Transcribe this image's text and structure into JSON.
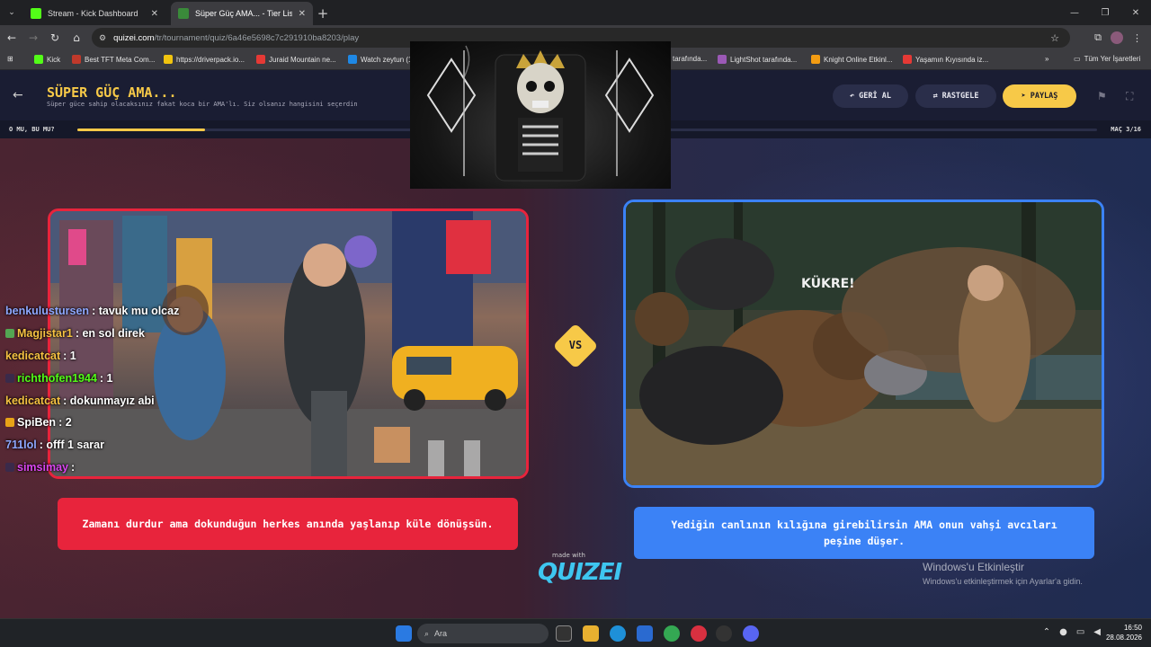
{
  "browser": {
    "tabs": [
      {
        "title": "Stream - Kick Dashboard",
        "favicon_color": "#53fc18"
      },
      {
        "title": "Süper Güç AMA... - Tier List, Kö",
        "favicon_color": "#3a8a3a"
      }
    ],
    "url_host": "quizei.com",
    "url_path": "/tr/tournament/quiz/6a46e5698c7c291910ba8203/play",
    "bookmarks": [
      {
        "label": "Kick",
        "color": "#53fc18"
      },
      {
        "label": "Best TFT Meta Com...",
        "color": "#c0392b"
      },
      {
        "label": "https://driverpack.io...",
        "color": "#f1c40f"
      },
      {
        "label": "Juraid Mountain ne...",
        "color": "#e53935"
      },
      {
        "label": "Watch zeytun (1",
        "color": "#1e88e5"
      },
      {
        "label": "tarafında...",
        "color": "#888888"
      },
      {
        "label": "LightShot tarafında...",
        "color": "#9b59b6"
      },
      {
        "label": "Knight Online Etkinl...",
        "color": "#f39c12"
      },
      {
        "label": "Yaşamın Kıyısında iz...",
        "color": "#e53935"
      }
    ],
    "all_bookmarks_label": "Tüm Yer İşaretleri"
  },
  "quiz": {
    "title": "SÜPER GÜÇ AMA...",
    "subtitle": "Süper güce sahip olacaksınız fakat koca bir AMA'lı. Siz olsanız hangisini seçerdin",
    "buttons": {
      "undo": "GERİ AL",
      "random": "RASTGELE",
      "share": "PAYLAŞ"
    },
    "progress_label": "O MU, BU MU?",
    "match_label": "MAÇ 3/16",
    "progress_fraction": 0.125,
    "vs_label": "VS",
    "left_option": "Zamanı durdur ama dokunduğun herkes anında yaşlanıp küle dönüşsün.",
    "right_option": "Yediğin canlının kılığına girebilirsin AMA onun vahşi avcıları peşine düşer.",
    "made_with": "made with",
    "logo": "QUIZEI"
  },
  "chat": [
    {
      "user": "benkulustursen",
      "msg": ": tavuk mu olcaz",
      "color": "#8fa8ff",
      "badge": ""
    },
    {
      "user": "Magjistar1",
      "msg": ": en sol direk",
      "color": "#f5c242",
      "badge": "#53a653"
    },
    {
      "user": "kedicatcat",
      "msg": ": 1",
      "color": "#f5c242",
      "badge": ""
    },
    {
      "user": "richthofen1944",
      "msg": ": 1",
      "color": "#53fc18",
      "badge": "#3a2a4a"
    },
    {
      "user": "kedicatcat",
      "msg": ": dokunmayız abi",
      "color": "#f5c242",
      "badge": ""
    },
    {
      "user": "SpiBen",
      "msg": ": 2",
      "color": "#ffffff",
      "badge": "#e8a317"
    },
    {
      "user": "711lol",
      "msg": ": offf 1 sarar",
      "color": "#8fa8ff",
      "badge": ""
    },
    {
      "user": "simsimay",
      "msg": ":",
      "color": "#d946ef",
      "badge": "#3a2a4a"
    }
  ],
  "windows": {
    "activate_title": "Windows'u Etkinleştir",
    "activate_sub": "Windows'u etkinleştirmek için Ayarlar'a gidin.",
    "search_placeholder": "Ara",
    "time": "16:50",
    "date": "28.08.2026"
  }
}
